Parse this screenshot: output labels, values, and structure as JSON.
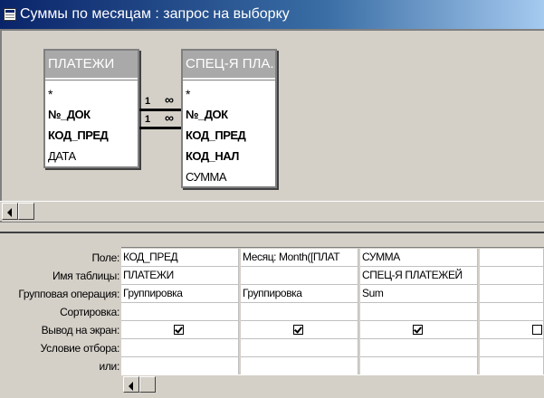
{
  "window": {
    "title": "Суммы по месяцам : запрос на выборку",
    "icon": "query-icon"
  },
  "tables": [
    {
      "title": "ПЛАТЕЖИ",
      "fields": [
        {
          "name": "*",
          "key": false
        },
        {
          "name": "№_ДОК",
          "key": true
        },
        {
          "name": "КОД_ПРЕД",
          "key": true
        },
        {
          "name": "ДАТА",
          "key": false
        }
      ]
    },
    {
      "title": "СПЕЦ-Я ПЛА...",
      "fields": [
        {
          "name": "*",
          "key": false
        },
        {
          "name": "№_ДОК",
          "key": true
        },
        {
          "name": "КОД_ПРЕД",
          "key": true
        },
        {
          "name": "КОД_НАЛ",
          "key": true
        },
        {
          "name": "СУММА",
          "key": false
        }
      ]
    }
  ],
  "relationships": [
    {
      "one": "1",
      "many": "∞"
    },
    {
      "one": "1",
      "many": "∞"
    }
  ],
  "grid": {
    "row_labels": [
      "Поле:",
      "Имя таблицы:",
      "Групповая операция:",
      "Сортировка:",
      "Вывод на экран:",
      "Условие отбора:",
      "или:"
    ],
    "columns": [
      {
        "field": "КОД_ПРЕД",
        "table": "ПЛАТЕЖИ",
        "total": "Группировка",
        "sort": "",
        "show": true,
        "criteria": "",
        "or": ""
      },
      {
        "field": "Месяц: Month([ПЛАТ",
        "table": "",
        "total": "Группировка",
        "sort": "",
        "show": true,
        "criteria": "",
        "or": ""
      },
      {
        "field": "СУММА",
        "table": "СПЕЦ-Я ПЛАТЕЖЕЙ",
        "total": "Sum",
        "sort": "",
        "show": true,
        "criteria": "",
        "or": ""
      },
      {
        "field": "",
        "table": "",
        "total": "",
        "sort": "",
        "show": false,
        "criteria": "",
        "or": ""
      }
    ]
  },
  "colors": {
    "title_start": "#0a246a",
    "title_end": "#a6caf0",
    "chrome": "#d4d0c8",
    "fieldlist_header": "#a9a9a9"
  }
}
